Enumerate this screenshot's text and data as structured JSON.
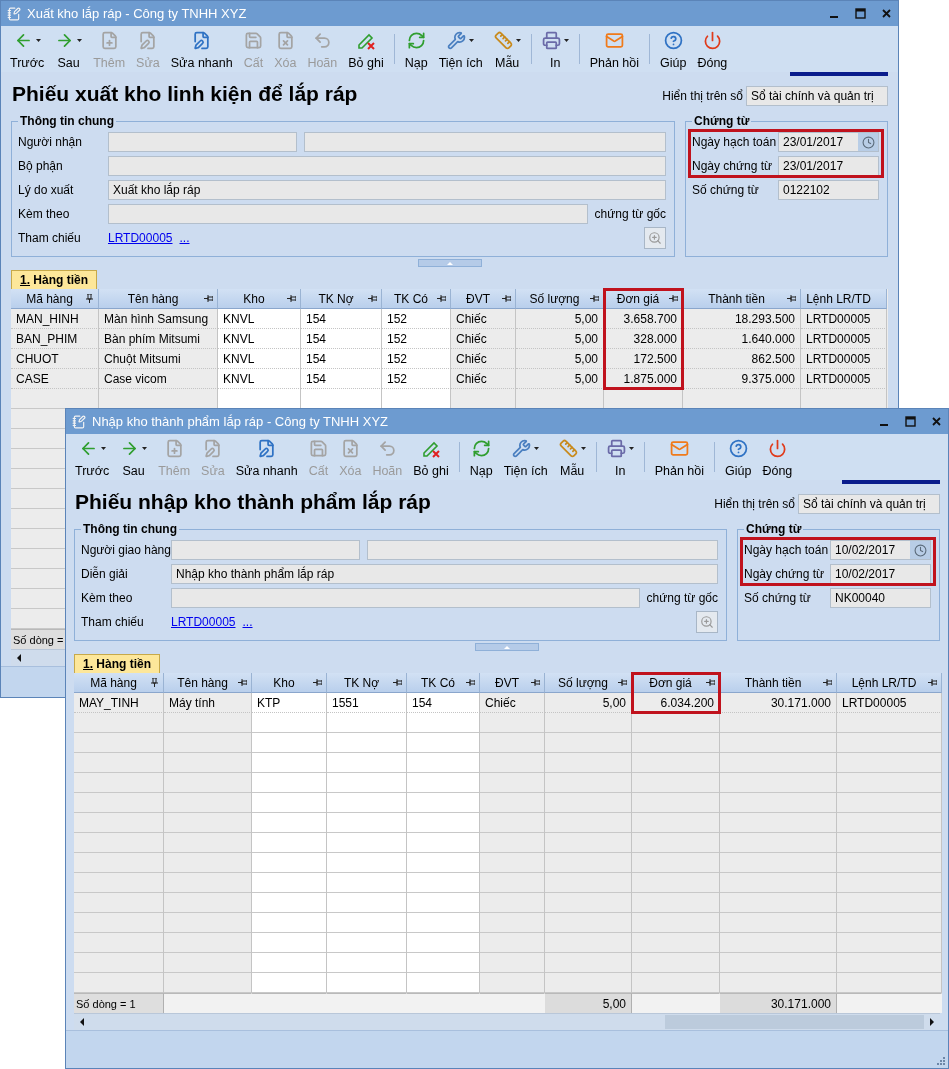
{
  "windows": [
    {
      "title": "Xuất kho lắp ráp - Công ty TNHH XYZ",
      "toolbar": [
        {
          "kind": "button",
          "label": "Trước",
          "disabled": false,
          "dropdown": true
        },
        {
          "kind": "button",
          "label": "Sau",
          "disabled": false,
          "dropdown": true
        },
        {
          "kind": "button",
          "label": "Thêm",
          "disabled": true,
          "dropdown": false
        },
        {
          "kind": "button",
          "label": "Sửa",
          "disabled": true,
          "dropdown": false
        },
        {
          "kind": "button",
          "label": "Sửa nhanh",
          "disabled": false,
          "dropdown": false
        },
        {
          "kind": "button",
          "label": "Cất",
          "disabled": true,
          "dropdown": false
        },
        {
          "kind": "button",
          "label": "Xóa",
          "disabled": true,
          "dropdown": false
        },
        {
          "kind": "button",
          "label": "Hoãn",
          "disabled": true,
          "dropdown": false
        },
        {
          "kind": "button",
          "label": "Bỏ ghi",
          "disabled": false,
          "dropdown": false
        },
        {
          "kind": "separator"
        },
        {
          "kind": "button",
          "label": "Nạp",
          "disabled": false,
          "dropdown": false
        },
        {
          "kind": "button",
          "label": "Tiện ích",
          "disabled": false,
          "dropdown": true
        },
        {
          "kind": "button",
          "label": "Mẫu",
          "disabled": false,
          "dropdown": true
        },
        {
          "kind": "separator"
        },
        {
          "kind": "button",
          "label": "In",
          "disabled": false,
          "dropdown": true
        },
        {
          "kind": "separator"
        },
        {
          "kind": "button",
          "label": "Phản hồi",
          "disabled": false,
          "dropdown": false
        },
        {
          "kind": "separator"
        },
        {
          "kind": "button",
          "label": "Giúp",
          "disabled": false,
          "dropdown": false
        },
        {
          "kind": "button",
          "label": "Đóng",
          "disabled": false,
          "dropdown": false
        }
      ],
      "heading": "Phiếu xuất kho linh kiện để lắp ráp",
      "ledger": {
        "label": "Hiển thị trên sổ",
        "value": "Sổ tài chính và quản trị"
      },
      "general": {
        "legend": "Thông tin chung",
        "rows": [
          {
            "kind": "pair",
            "label": "Người nhận"
          },
          {
            "kind": "field",
            "label": "Bộ phận"
          },
          {
            "kind": "field",
            "label": "Lý do xuất",
            "value": "Xuất kho lắp ráp"
          },
          {
            "kind": "suffix",
            "label": "Kèm theo",
            "suffix": "chứng từ gốc"
          },
          {
            "kind": "link",
            "label": "Tham chiếu",
            "link": "LRTD00005",
            "more": "..."
          }
        ]
      },
      "voucher": {
        "legend": "Chứng từ",
        "rows": [
          {
            "kind": "date",
            "label": "Ngày hạch toán",
            "value": "23/01/2017",
            "highlighted": true
          },
          {
            "kind": "field",
            "label": "Ngày chứng từ",
            "value": "23/01/2017",
            "highlighted": true
          },
          {
            "kind": "field",
            "label": "Số chứng từ",
            "value": "0122102",
            "highlighted": false
          }
        ]
      },
      "tab": {
        "label": "1. Hàng tiền",
        "selected": true
      },
      "table": {
        "columns": [
          {
            "label": "Mã hàng",
            "kind": "text",
            "editable": false,
            "pinned": true,
            "highlighted": false
          },
          {
            "label": "Tên hàng",
            "kind": "text",
            "editable": false,
            "pinned": false,
            "highlighted": false
          },
          {
            "label": "Kho",
            "kind": "text",
            "editable": true,
            "pinned": false,
            "highlighted": false
          },
          {
            "label": "TK Nợ",
            "kind": "text",
            "editable": true,
            "pinned": false,
            "highlighted": false
          },
          {
            "label": "TK Có",
            "kind": "text",
            "editable": true,
            "pinned": false,
            "highlighted": false
          },
          {
            "label": "ĐVT",
            "kind": "text",
            "editable": false,
            "pinned": false,
            "highlighted": false
          },
          {
            "label": "Số lượng",
            "kind": "number",
            "editable": false,
            "pinned": false,
            "highlighted": false
          },
          {
            "label": "Đơn giá",
            "kind": "number",
            "editable": false,
            "pinned": false,
            "highlighted": true
          },
          {
            "label": "Thành tiền",
            "kind": "number",
            "editable": false,
            "pinned": false,
            "highlighted": false
          },
          {
            "label": "Lệnh LR/TD",
            "kind": "text",
            "editable": false,
            "highlighted": false
          }
        ],
        "rows": [
          [
            "MAN_HINH",
            "Màn hình Samsung",
            "KNVL",
            "154",
            "152",
            "Chiếc",
            "5,00",
            "3.658.700",
            "18.293.500",
            "LRTD00005"
          ],
          [
            "BAN_PHIM",
            "Bàn phím Mitsumi",
            "KNVL",
            "154",
            "152",
            "Chiếc",
            "5,00",
            "328.000",
            "1.640.000",
            "LRTD00005"
          ],
          [
            "CHUOT",
            "Chuột Mitsumi",
            "KNVL",
            "154",
            "152",
            "Chiếc",
            "5,00",
            "172.500",
            "862.500",
            "LRTD00005"
          ],
          [
            "CASE",
            "Case vicom",
            "KNVL",
            "154",
            "152",
            "Chiếc",
            "5,00",
            "1.875.000",
            "9.375.000",
            "LRTD00005"
          ]
        ],
        "footer": {
          "label": "Số dòng ="
        }
      }
    },
    {
      "title": "Nhập kho thành phẩm lắp ráp - Công ty TNHH XYZ",
      "toolbar": [
        {
          "kind": "button",
          "label": "Trước",
          "disabled": false,
          "dropdown": true
        },
        {
          "kind": "button",
          "label": "Sau",
          "disabled": false,
          "dropdown": true
        },
        {
          "kind": "button",
          "label": "Thêm",
          "disabled": true,
          "dropdown": false
        },
        {
          "kind": "button",
          "label": "Sửa",
          "disabled": true,
          "dropdown": false
        },
        {
          "kind": "button",
          "label": "Sửa nhanh",
          "disabled": false,
          "dropdown": false
        },
        {
          "kind": "button",
          "label": "Cất",
          "disabled": true,
          "dropdown": false
        },
        {
          "kind": "button",
          "label": "Xóa",
          "disabled": true,
          "dropdown": false
        },
        {
          "kind": "button",
          "label": "Hoãn",
          "disabled": true,
          "dropdown": false
        },
        {
          "kind": "button",
          "label": "Bỏ ghi",
          "disabled": false,
          "dropdown": false
        },
        {
          "kind": "separator"
        },
        {
          "kind": "button",
          "label": "Nạp",
          "disabled": false,
          "dropdown": false
        },
        {
          "kind": "button",
          "label": "Tiện ích",
          "disabled": false,
          "dropdown": true
        },
        {
          "kind": "button",
          "label": "Mẫu",
          "disabled": false,
          "dropdown": true
        },
        {
          "kind": "separator"
        },
        {
          "kind": "button",
          "label": "In",
          "disabled": false,
          "dropdown": true
        },
        {
          "kind": "separator"
        },
        {
          "kind": "button",
          "label": "Phản hồi",
          "disabled": false,
          "dropdown": false
        },
        {
          "kind": "separator"
        },
        {
          "kind": "button",
          "label": "Giúp",
          "disabled": false,
          "dropdown": false
        },
        {
          "kind": "button",
          "label": "Đóng",
          "disabled": false,
          "dropdown": false
        }
      ],
      "heading": "Phiếu nhập kho thành phẩm lắp ráp",
      "ledger": {
        "label": "Hiển thị trên sổ",
        "value": "Sổ tài chính và quản trị"
      },
      "general": {
        "legend": "Thông tin chung",
        "rows": [
          {
            "kind": "pair",
            "label": "Người giao hàng"
          },
          {
            "kind": "field",
            "label": "Diễn giải",
            "value": "Nhập kho thành phẩm lắp ráp"
          },
          {
            "kind": "suffix",
            "label": "Kèm theo",
            "suffix": "chứng từ gốc"
          },
          {
            "kind": "link",
            "label": "Tham chiếu",
            "link": "LRTD00005",
            "more": "..."
          }
        ]
      },
      "voucher": {
        "legend": "Chứng từ",
        "rows": [
          {
            "kind": "date",
            "label": "Ngày hạch toán",
            "value": "10/02/2017",
            "highlighted": true
          },
          {
            "kind": "field",
            "label": "Ngày chứng từ",
            "value": "10/02/2017",
            "highlighted": true
          },
          {
            "kind": "field",
            "label": "Số chứng từ",
            "value": "NK00040",
            "highlighted": false
          }
        ]
      },
      "tab": {
        "label": "1. Hàng tiền",
        "selected": true
      },
      "table": {
        "columns": [
          {
            "label": "Mã hàng",
            "kind": "text",
            "editable": false,
            "pinned": true,
            "highlighted": false
          },
          {
            "label": "Tên hàng",
            "kind": "text",
            "editable": false,
            "pinned": false,
            "highlighted": false
          },
          {
            "label": "Kho",
            "kind": "text",
            "editable": true,
            "pinned": false,
            "highlighted": false
          },
          {
            "label": "TK Nợ",
            "kind": "text",
            "editable": true,
            "pinned": false,
            "highlighted": false
          },
          {
            "label": "TK Có",
            "kind": "text",
            "editable": true,
            "pinned": false,
            "highlighted": false
          },
          {
            "label": "ĐVT",
            "kind": "text",
            "editable": false,
            "pinned": false,
            "highlighted": false
          },
          {
            "label": "Số lượng",
            "kind": "number",
            "editable": false,
            "pinned": false,
            "highlighted": false,
            "total": "5,00"
          },
          {
            "label": "Đơn giá",
            "kind": "number",
            "editable": false,
            "pinned": false,
            "highlighted": true
          },
          {
            "label": "Thành tiền",
            "kind": "number",
            "editable": false,
            "pinned": false,
            "highlighted": false,
            "total": "30.171.000"
          },
          {
            "label": "Lệnh LR/TD",
            "kind": "text",
            "editable": false,
            "pinned": false,
            "highlighted": false
          }
        ],
        "rows": [
          [
            "MAY_TINH",
            "Máy tính",
            "KTP",
            "1551",
            "154",
            "Chiếc",
            "5,00",
            "6.034.200",
            "30.171.000",
            "LRTD00005"
          ]
        ],
        "footer": {
          "label": "Số dòng = 1"
        }
      }
    }
  ]
}
